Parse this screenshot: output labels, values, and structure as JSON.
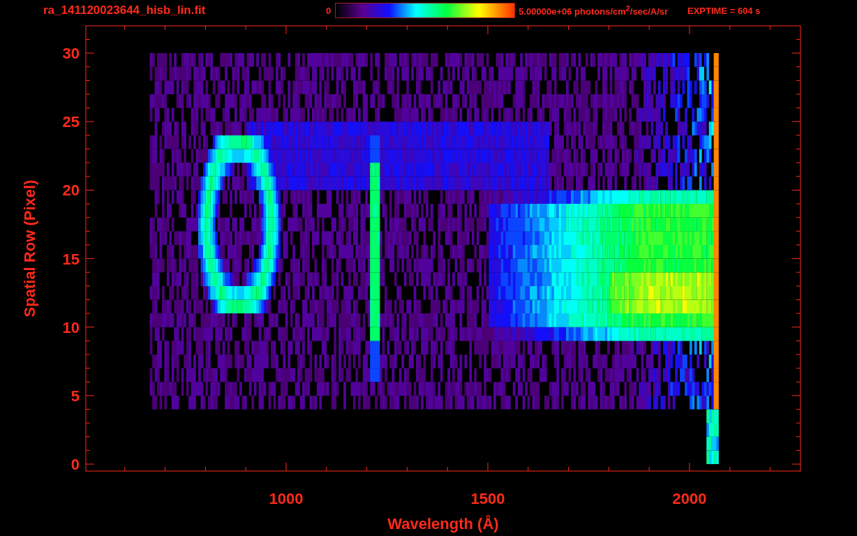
{
  "title": "ra_141120023644_hisb_lin.fit",
  "colorbar": {
    "min_label": "0",
    "max_label": "5.00000e+06 photons/cm$^{2}$/sec/A/sr"
  },
  "exptime": "EXPTIME = 604 s",
  "plot": {
    "xlabel": "Wavelength (Å)",
    "ylabel": "Spatial Row (Pixel)",
    "xticks": [
      "1000",
      "1500",
      "2000"
    ],
    "yticks": [
      "30",
      "25",
      "20",
      "15",
      "10",
      "5",
      "0"
    ]
  }
}
